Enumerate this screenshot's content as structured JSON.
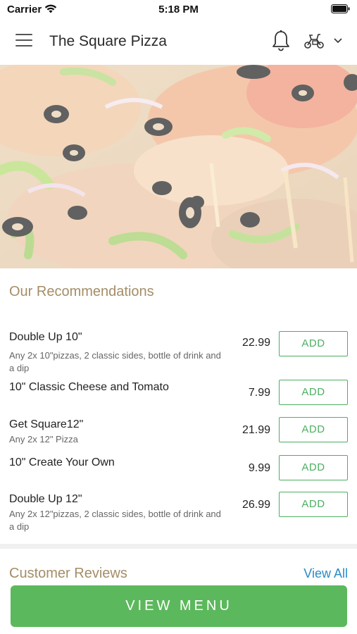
{
  "status_bar": {
    "carrier": "Carrier",
    "time": "5:18 PM"
  },
  "header": {
    "title": "The Square Pizza",
    "icons": [
      "hamburger-menu-icon",
      "bell-icon",
      "scooter-icon",
      "chevron-down-icon"
    ]
  },
  "hero": {
    "image": "pizza-photo"
  },
  "recommendations": {
    "title": "Our Recommendations",
    "add_label": "ADD",
    "items": [
      {
        "name": "Double Up 10\"",
        "description": "Any 2x 10\"pizzas, 2 classic sides, bottle of drink and a dip",
        "price": "22.99"
      },
      {
        "name": "10\" Classic Cheese and Tomato",
        "description": "",
        "price": "7.99"
      },
      {
        "name": "Get Square12\"",
        "description": "Any 2x 12\" Pizza",
        "price": "21.99"
      },
      {
        "name": "10\" Create Your Own",
        "description": "",
        "price": "9.99"
      },
      {
        "name": "Double Up 12\"",
        "description": "Any 2x 12\"pizzas, 2 classic sides, bottle of drink and a dip",
        "price": "26.99"
      }
    ]
  },
  "reviews": {
    "title": "Customer Reviews",
    "view_all": "View All"
  },
  "footer": {
    "view_menu": "VIEW MENU"
  },
  "colors": {
    "accent_green": "#4caf62",
    "button_green": "#5cb85c",
    "section_title": "#a48d66",
    "link_blue": "#2a8ac8"
  }
}
